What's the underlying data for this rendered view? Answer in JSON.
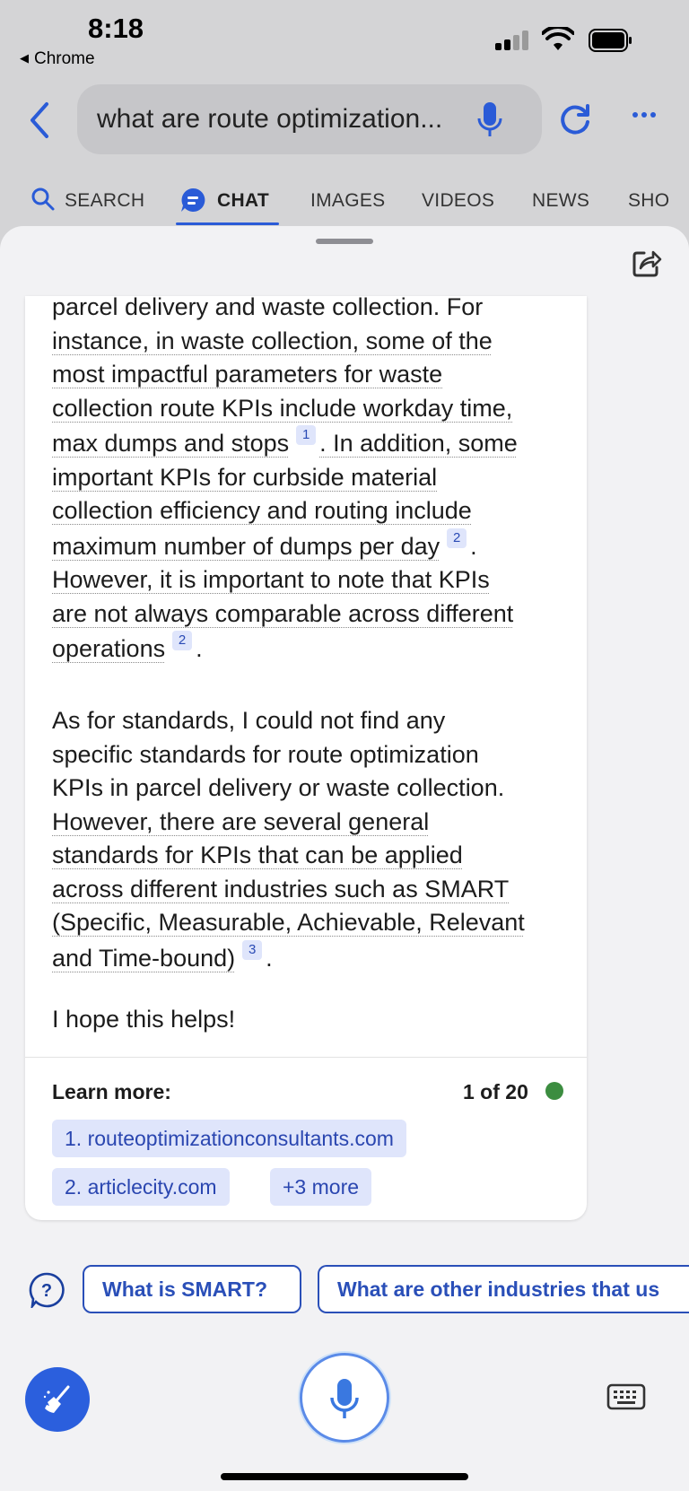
{
  "status_bar": {
    "time": "8:18",
    "back_app": "Chrome"
  },
  "search": {
    "query": "what are route optimization..."
  },
  "tabs": [
    {
      "label": "SEARCH",
      "icon": "search-icon"
    },
    {
      "label": "CHAT",
      "icon": "chat-icon",
      "active": true
    },
    {
      "label": "IMAGES"
    },
    {
      "label": "VIDEOS"
    },
    {
      "label": "NEWS"
    },
    {
      "label": "SHO"
    }
  ],
  "answer": {
    "p1": {
      "l1": "parcel delivery and waste collection. For",
      "l2": "instance, in waste collection, some of the",
      "l3": "most impactful parameters for waste",
      "l4": "collection route KPIs include workday time,",
      "l5": "max dumps and stops",
      "c1": "1",
      "l5b": ". In addition, some",
      "l6": "important KPIs for curbside material",
      "l7": "collection efficiency and routing include",
      "l8": "maximum number of dumps per day",
      "c2": "2",
      "l8b": ".",
      "l9": "However, it is important to note that KPIs",
      "l10": "are not always comparable across different",
      "l11": "operations",
      "c3": "2",
      "l11b": "."
    },
    "p2": {
      "l1": "As for standards, I could not find any",
      "l2": "specific standards for route optimization",
      "l3": "KPIs in parcel delivery or waste collection.",
      "l4": "However, there are several general",
      "l5": "standards for KPIs that can be applied",
      "l6": "across different industries such as SMART",
      "l7": "(Specific, Measurable, Achievable, Relevant",
      "l8": "and Time-bound)",
      "c1": "3",
      "l8b": "."
    },
    "p3": "I hope this helps!"
  },
  "learn_more": {
    "label": "Learn more:",
    "counter": "1 of 20",
    "links": [
      "1. routeoptimizationconsultants.com",
      "2. articlecity.com",
      "+3 more"
    ]
  },
  "suggestions": [
    "What is SMART?",
    "What are other industries that us"
  ],
  "colors": {
    "accent": "#2a5bd7",
    "chip_bg": "#dfe5fb",
    "status_dot": "#3c8d40"
  }
}
